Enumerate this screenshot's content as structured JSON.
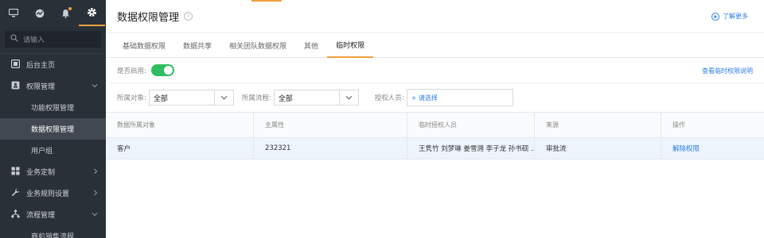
{
  "sidebar": {
    "search_placeholder": "请输入",
    "items": [
      {
        "label": "后台主页",
        "icon": "dashboard-icon"
      },
      {
        "label": "权限管理",
        "icon": "permission-icon",
        "expanded": true,
        "children": [
          {
            "label": "功能权限管理",
            "active": false
          },
          {
            "label": "数据权限管理",
            "active": true
          },
          {
            "label": "用户组",
            "active": false
          }
        ]
      },
      {
        "label": "业务定制",
        "icon": "grid-icon"
      },
      {
        "label": "业务规则设置",
        "icon": "wrench-icon"
      },
      {
        "label": "流程管理",
        "icon": "flow-icon",
        "expanded": true,
        "children": [
          {
            "label": "商机销售流程",
            "active": false
          }
        ]
      }
    ]
  },
  "header": {
    "title": "数据权限管理",
    "help": "?",
    "learn_more": "了解更多"
  },
  "tabs": [
    {
      "label": "基础数据权限",
      "active": false
    },
    {
      "label": "数据共享",
      "active": false
    },
    {
      "label": "相关团队数据权限",
      "active": false
    },
    {
      "label": "其他",
      "active": false
    },
    {
      "label": "临时权限",
      "active": true
    }
  ],
  "enable": {
    "label": "是否启用:",
    "on": true,
    "explain_link": "查看临时权限说明"
  },
  "filters": {
    "object_label": "所属对象:",
    "object_value": "全部",
    "flow_label": "所属流程:",
    "flow_value": "全部",
    "grantee_label": "授权人员:",
    "grantee_placeholder": "+ 请选择"
  },
  "table": {
    "columns": [
      "数据所属对象",
      "主属性",
      "临时授权人员",
      "来源",
      "操作"
    ],
    "rows": [
      {
        "object": "客户",
        "main_attr": "232321",
        "grantees": "王隽竹 刘梦琳 姜雪溯 李子龙 孙书砚 ...",
        "source": "审批流",
        "action": "解除权限"
      }
    ]
  },
  "colors": {
    "sidebar_bg": "#2a3038",
    "accent": "#f0a040",
    "link": "#2b7de9",
    "toggle_on": "#2ebd5f",
    "selected_row": "#eef4fc"
  }
}
